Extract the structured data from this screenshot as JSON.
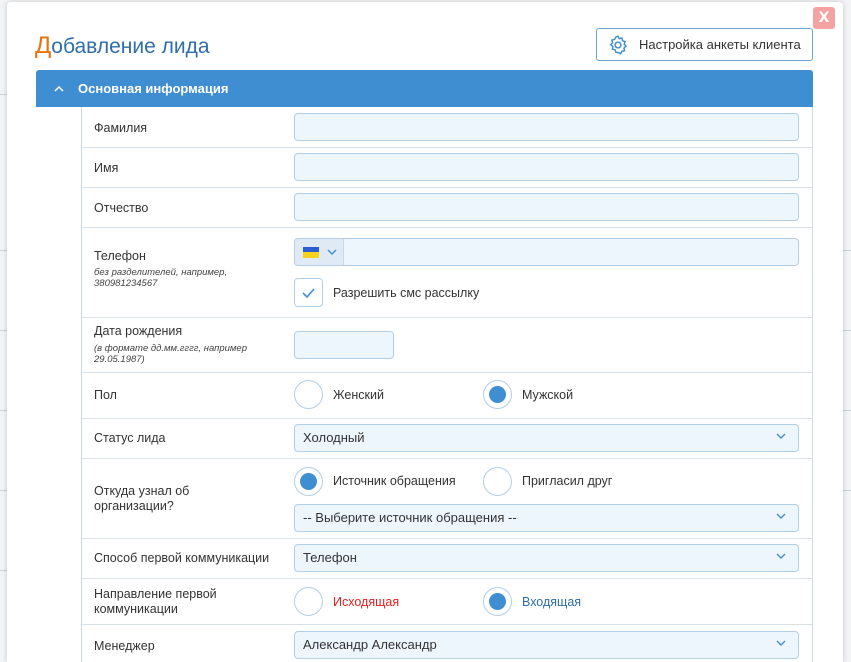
{
  "modal": {
    "title_first_letter": "Д",
    "title_rest": "обавление лида",
    "close_label": "X",
    "settings_button_label": "Настройка анкеты клиента"
  },
  "section": {
    "title": "Основная информация"
  },
  "fields": {
    "last_name": {
      "label": "Фамилия",
      "value": ""
    },
    "first_name": {
      "label": "Имя",
      "value": ""
    },
    "middle_name": {
      "label": "Отчество",
      "value": ""
    },
    "phone": {
      "label": "Телефон",
      "hint": "без разделителей, например, 380981234567",
      "value": "",
      "country_flag": "ukraine-flag-icon",
      "sms_checkbox_label": "Разрешить смс рассылку",
      "sms_checked": true
    },
    "birth_date": {
      "label": "Дата рождения",
      "hint": "(в формате дд.мм.гггг, например 29.05.1987)",
      "value": ""
    },
    "gender": {
      "label": "Пол",
      "options": [
        {
          "label": "Женский",
          "selected": false
        },
        {
          "label": "Мужской",
          "selected": true
        }
      ]
    },
    "lead_status": {
      "label": "Статус лида",
      "value": "Холодный"
    },
    "source": {
      "label": "Откуда узнал об организации?",
      "options": [
        {
          "label": "Источник обращения",
          "selected": true
        },
        {
          "label": "Пригласил друг",
          "selected": false
        }
      ],
      "select_value": "-- Выберите источник обращения --"
    },
    "first_comm_method": {
      "label": "Способ первой коммуникации",
      "value": "Телефон"
    },
    "first_comm_direction": {
      "label": "Направление первой коммуникации",
      "options": [
        {
          "label": "Исходящая",
          "selected": false
        },
        {
          "label": "Входящая",
          "selected": true
        }
      ]
    },
    "manager": {
      "label": "Менеджер",
      "value": "Александр Александр"
    }
  },
  "colors": {
    "accent": "#3f8ed2",
    "title_accent": "#e8720c",
    "title": "#2f6ea8",
    "outgoing_label": "#e02020",
    "incoming_label": "#2f6ea8",
    "input_bg": "#eef6fd",
    "close_bg": "#f4a3a3"
  }
}
